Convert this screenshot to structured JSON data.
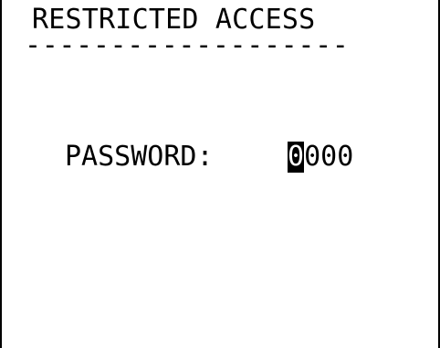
{
  "screen": {
    "title": "RESTRICTED ACCESS",
    "divider": "-------------------"
  },
  "password": {
    "label": "PASSWORD:",
    "digits": [
      "0",
      "0",
      "0",
      "0"
    ],
    "cursor_index": 0
  },
  "colors": {
    "background": "#ffffff",
    "text": "#000000",
    "cursor_background": "#000000",
    "cursor_text": "#ffffff"
  }
}
